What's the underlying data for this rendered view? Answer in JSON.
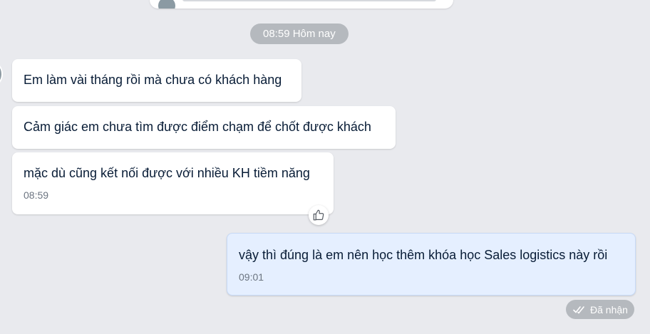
{
  "chat": {
    "time_divider": "08:59 Hôm nay",
    "messages": [
      {
        "text": "Em làm vài tháng rồi mà chưa có khách hàng"
      },
      {
        "text": "Cảm giác em chưa tìm được điểm chạm để chốt được khách"
      },
      {
        "text": "mặc dù cũng kết nối được với nhiều KH tiềm năng",
        "time": "08:59"
      },
      {
        "text": "vậy thì đúng là em nên học thêm khóa học Sales logistics này rồi",
        "time": "09:01"
      }
    ],
    "delivery_status": "Đã nhận",
    "icons": {
      "like": "thumbs-up-icon",
      "status": "double-check-icon"
    }
  },
  "colors": {
    "background": "#e9eaee",
    "incoming_bubble": "#ffffff",
    "outgoing_bubble": "#e5efff",
    "chip": "#b5b9be",
    "text": "#081c36",
    "meta_text": "#6b7480"
  }
}
